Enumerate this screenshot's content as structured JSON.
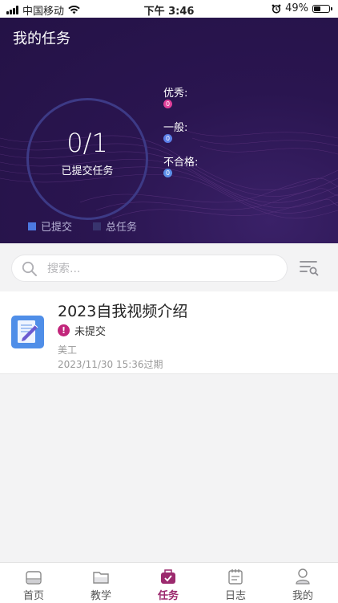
{
  "status_bar": {
    "carrier": "中国移动",
    "time": "下午 3:46",
    "battery": "49%"
  },
  "header": {
    "title": "我的任务",
    "progress_text": "0/1",
    "progress_label": "已提交任务",
    "stats": [
      {
        "label": "优秀:",
        "value": "0",
        "color": "#e0409a"
      },
      {
        "label": "一般:",
        "value": "0",
        "color": "#5b7fe8"
      },
      {
        "label": "不合格:",
        "value": "0",
        "color": "#5b8fe8"
      }
    ],
    "legend": [
      {
        "label": "已提交",
        "color": "#4c78e0"
      },
      {
        "label": "总任务",
        "color": "#38346e"
      }
    ]
  },
  "search": {
    "placeholder": "搜索..."
  },
  "tasks": [
    {
      "title": "2023自我视频介绍",
      "status": "未提交",
      "category": "美工",
      "deadline": "2023/11/30 15:36过期"
    }
  ],
  "tabbar": {
    "items": [
      {
        "label": "首页"
      },
      {
        "label": "教学"
      },
      {
        "label": "任务"
      },
      {
        "label": "日志"
      },
      {
        "label": "我的"
      }
    ],
    "active_color": "#9c2a6e"
  }
}
